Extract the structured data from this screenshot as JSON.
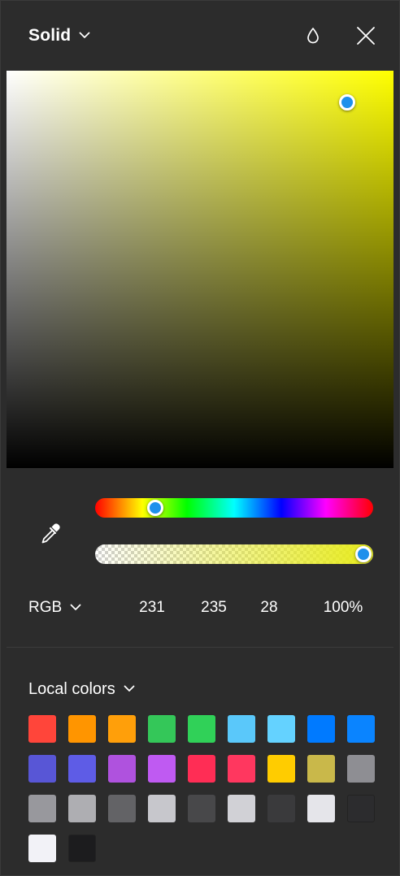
{
  "header": {
    "mode_label": "Solid",
    "icons": {
      "mode_dropdown": "chevron-down-icon",
      "blend": "drop-icon",
      "close": "close-icon"
    }
  },
  "picker": {
    "hue_color": "#ffff00",
    "saturation": 0.88,
    "brightness": 0.92,
    "hue_position": 0.196,
    "alpha_position": 1.0
  },
  "eyedropper": {
    "icon": "eyedropper-icon"
  },
  "values": {
    "format": "RGB",
    "r": "231",
    "g": "235",
    "b": "28",
    "alpha": "100%"
  },
  "library": {
    "label": "Local colors",
    "swatches": [
      "#ff453a",
      "#ff9500",
      "#ff9f0a",
      "#34c759",
      "#30d158",
      "#5ac8fa",
      "#64d2ff",
      "#007aff",
      "#0a84ff",
      "#5856d6",
      "#5e5ce6",
      "#af52de",
      "#bf5af2",
      "#ff2d55",
      "#ff375f",
      "#ffcc00",
      "#c9b84a",
      "#8e8e93",
      "#98989d",
      "#aeaeb2",
      "#636366",
      "#c7c7cc",
      "#48484a",
      "#d1d1d6",
      "#3a3a3c",
      "#e5e5ea",
      "#2c2c2e",
      "#f2f2f7",
      "#1c1c1e"
    ]
  }
}
